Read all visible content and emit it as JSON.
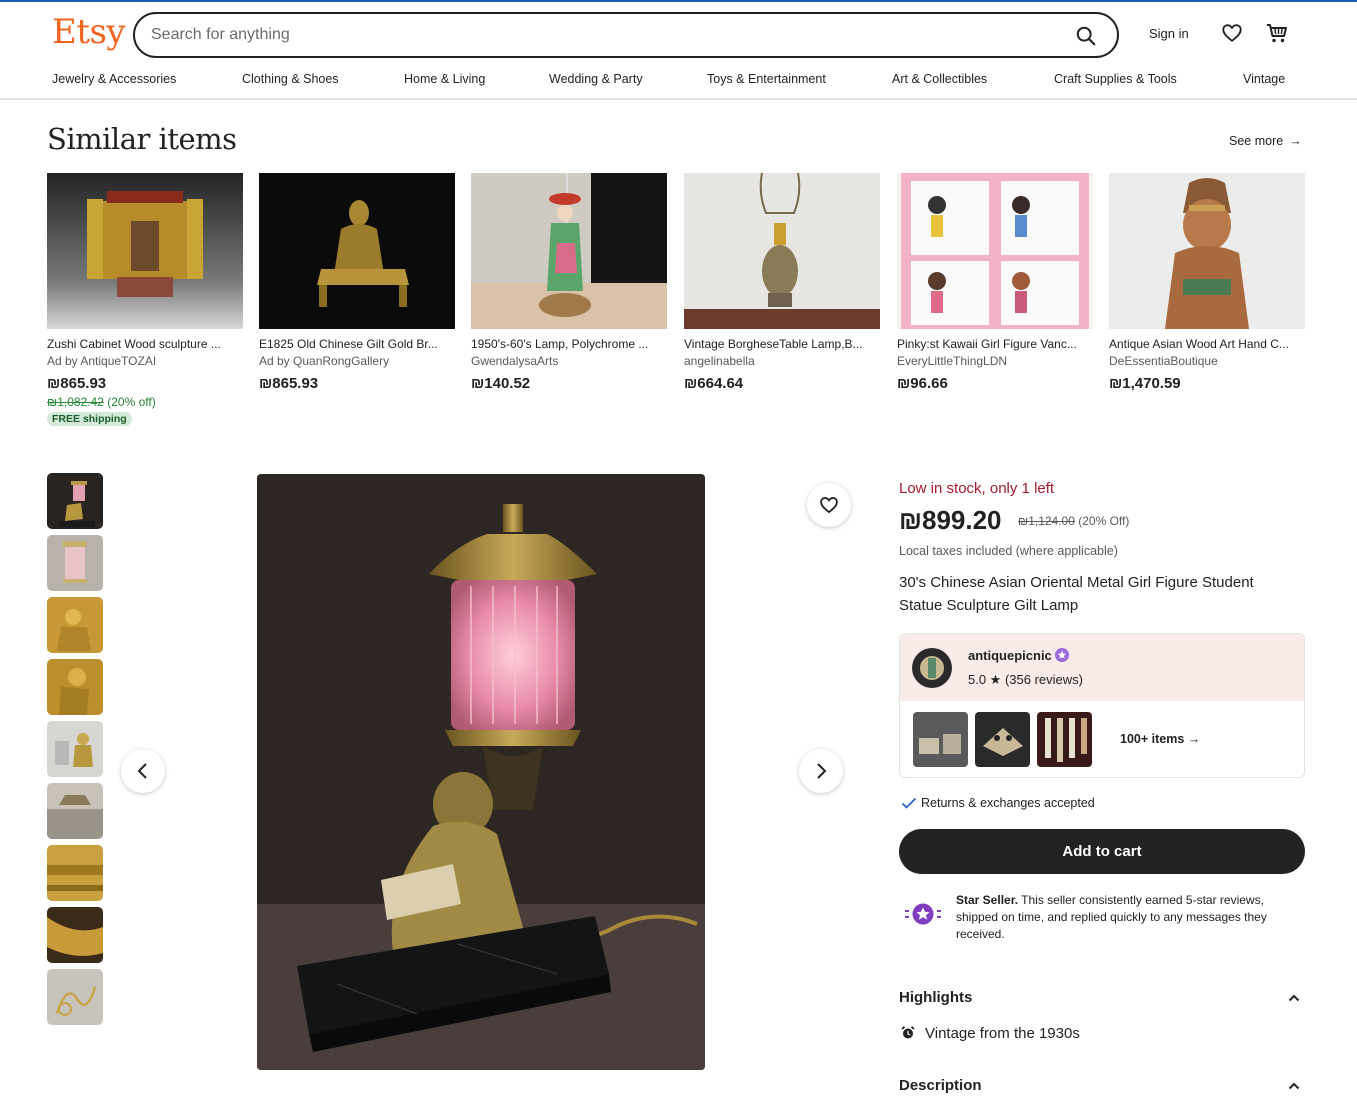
{
  "header": {
    "logo": "Etsy",
    "search_placeholder": "Search for anything",
    "signin_label": "Sign in",
    "categories": [
      "Jewelry & Accessories",
      "Clothing & Shoes",
      "Home & Living",
      "Wedding & Party",
      "Toys & Entertainment",
      "Art & Collectibles",
      "Craft Supplies & Tools",
      "Vintage"
    ],
    "icons": [
      "search-icon",
      "heart-icon",
      "cart-icon"
    ]
  },
  "similar": {
    "title": "Similar items",
    "see_more": "See more",
    "items": [
      {
        "title": "Zushi Cabinet Wood sculpture ...",
        "seller": "Ad by AntiqueTOZAI",
        "price": "₪865.93",
        "orig_price": "₪1,082.42",
        "discount": "(20% off)",
        "shipping": "FREE shipping"
      },
      {
        "title": "E1825 Old Chinese Gilt Gold Br...",
        "seller": "Ad by QuanRongGallery",
        "price": "₪865.93"
      },
      {
        "title": "1950's-60's Lamp, Polychrome ...",
        "seller": "GwendalysaArts",
        "price": "₪140.52"
      },
      {
        "title": "Vintage BorgheseTable Lamp,B...",
        "seller": "angelinabella",
        "price": "₪664.64"
      },
      {
        "title": "Pinky:st Kawaii Girl Figure Vanc...",
        "seller": "EveryLittleThingLDN",
        "price": "₪96.66"
      },
      {
        "title": "Antique Asian Wood Art Hand C...",
        "seller": "DeEssentiaBoutique",
        "price": "₪1,470.59"
      }
    ]
  },
  "listing": {
    "stock": "Low in stock, only 1 left",
    "price": "₪899.20",
    "orig_price": "₪1,124.00",
    "discount": "(20% Off)",
    "tax_note": "Local taxes included (where applicable)",
    "title": "30's Chinese Asian Oriental Metal Girl Figure Student Statue Sculpture Gilt Lamp",
    "shop": {
      "name": "antiquepicnic",
      "rating": "5.0 ★ (356 reviews)",
      "more_items": "100+ items"
    },
    "returns": "Returns & exchanges accepted",
    "add_to_cart": "Add to cart",
    "star_seller_title": "Star Seller.",
    "star_seller_text": "This seller consistently earned 5-star reviews, shipped on time, and replied quickly to any messages they received.",
    "highlights_label": "Highlights",
    "highlight_item": "Vintage from the 1930s",
    "description_label": "Description"
  },
  "colors": {
    "brand": "#f1641e",
    "stock_red": "#a61a2e",
    "discount_green": "#258635",
    "shop_header_bg": "#f9ece8",
    "star_purple": "#7f3ec0"
  }
}
